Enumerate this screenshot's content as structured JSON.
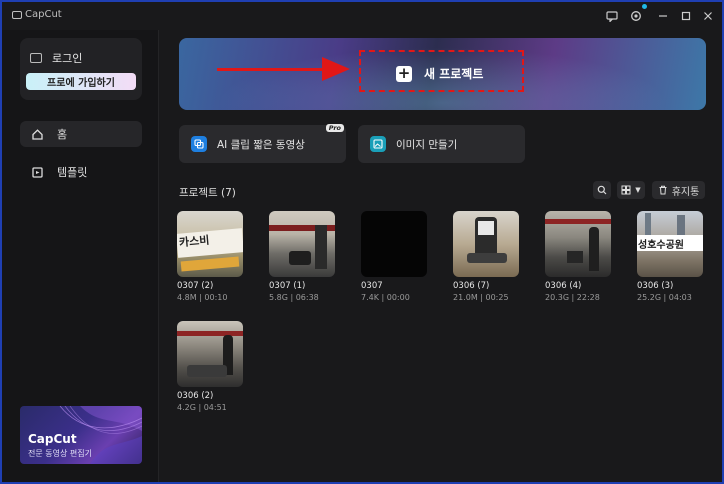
{
  "titlebar": {
    "app_name": "CapCut"
  },
  "sidebar": {
    "login_label": "로그인",
    "signup_label": "프로에 가입하기",
    "nav": [
      {
        "label": "홈",
        "icon": "home-icon"
      },
      {
        "label": "템플릿",
        "icon": "template-icon"
      }
    ],
    "promo": {
      "title": "CapCut",
      "subtitle": "전문 동영상 편집기"
    }
  },
  "banner": {
    "new_project_label": "새 프로젝트"
  },
  "tools": [
    {
      "label": "AI 클립 짧은 동영상",
      "badge": "Pro"
    },
    {
      "label": "이미지 만들기"
    }
  ],
  "projects": {
    "header": "프로젝트 (7)",
    "trash_label": "휴지통",
    "items": [
      {
        "name": "0307 (2)",
        "meta": "4.8M | 00:10",
        "thumb_text": "카스비"
      },
      {
        "name": "0307 (1)",
        "meta": "5.8G | 06:38"
      },
      {
        "name": "0307",
        "meta": "7.4K | 00:00"
      },
      {
        "name": "0306 (7)",
        "meta": "21.0M | 00:25"
      },
      {
        "name": "0306 (4)",
        "meta": "20.3G | 22:28"
      },
      {
        "name": "0306 (3)",
        "meta": "25.2G | 04:03",
        "thumb_text": "성호수공원"
      },
      {
        "name": "0306 (2)",
        "meta": "4.2G | 04:51"
      }
    ]
  }
}
